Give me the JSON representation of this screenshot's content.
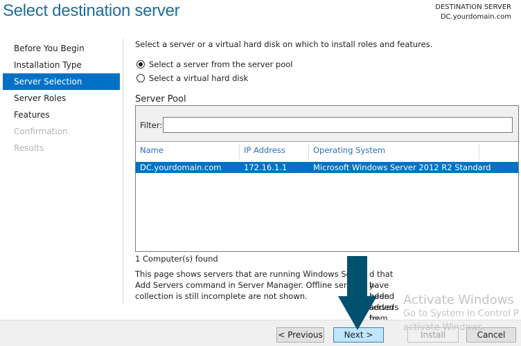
{
  "header": {
    "title": "Select destination server",
    "dest_label": "DESTINATION SERVER",
    "dest_value": "DC.yourdomain.com"
  },
  "nav": [
    {
      "label": "Before You Begin"
    },
    {
      "label": "Installation Type"
    },
    {
      "label": "Server Selection",
      "active": true
    },
    {
      "label": "Server Roles"
    },
    {
      "label": "Features"
    },
    {
      "label": "Confirmation",
      "disabled": true
    },
    {
      "label": "Results",
      "disabled": true
    }
  ],
  "main": {
    "intro": "Select a server or a virtual hard disk on which to install roles and features.",
    "options": [
      {
        "label": "Select a server from the server pool",
        "selected": true
      },
      {
        "label": "Select a virtual hard disk",
        "selected": false
      }
    ],
    "pool_title": "Server Pool",
    "filter_label": "Filter:",
    "filter_value": "",
    "columns": [
      "Name",
      "IP Address",
      "Operating System"
    ],
    "rows": [
      {
        "name": "DC.yourdomain.com",
        "ip": "172.16.1.1",
        "os": "Microsoft Windows Server 2012 R2 Standard"
      }
    ],
    "count": "1 Computer(s) found",
    "desc_lines": [
      [
        "This page shows servers that are running Windows Ser",
        "d that have been added by using the"
      ],
      [
        "Add Servers command in Server Manager. Offline serv",
        "y-added servers from which data"
      ],
      [
        "collection is still incomplete are not shown.",
        ""
      ]
    ]
  },
  "watermark": {
    "title": "Activate Windows",
    "line1": "Go to System in Control P",
    "line2": "activate Windows."
  },
  "buttons": {
    "previous": "< Previous",
    "next": "Next >",
    "install": "Install",
    "cancel": "Cancel"
  },
  "colors": {
    "accent": "#0072c6",
    "arrow": "#00506e"
  }
}
